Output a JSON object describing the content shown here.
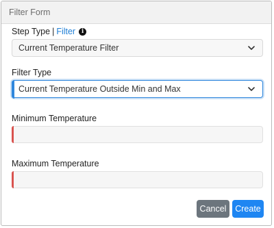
{
  "panel": {
    "title": "Filter Form"
  },
  "step_type": {
    "label": "Step Type",
    "separator": "|",
    "link": "Filter",
    "info_icon": "i",
    "selected": "Current Temperature Filter"
  },
  "filter_type": {
    "label": "Filter Type",
    "selected": "Current Temperature Outside Min and Max"
  },
  "min_temp": {
    "label": "Minimum Temperature",
    "value": ""
  },
  "max_temp": {
    "label": "Maximum Temperature",
    "value": ""
  },
  "buttons": {
    "cancel": "Cancel",
    "create": "Create"
  },
  "colors": {
    "accent": "#2f87dd",
    "required": "#d9534f",
    "cancel": "#6c757d",
    "create": "#1f86f2"
  }
}
